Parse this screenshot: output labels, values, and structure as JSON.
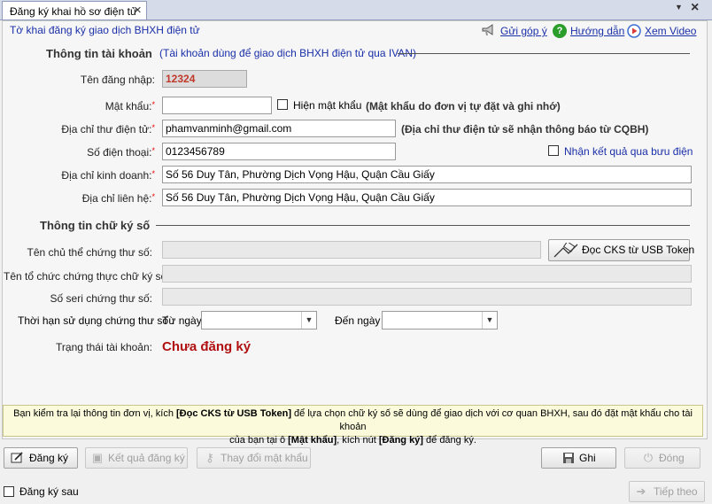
{
  "tab": {
    "title": "Đăng ký khai hồ sơ điện tử"
  },
  "header": {
    "subtitle": "Tờ khai đăng ký giao dịch BHXH điện tử",
    "feedback_label": "Gửi góp ý",
    "help_label": "Hướng dẫn",
    "video_label": "Xem Video"
  },
  "account": {
    "section_title": "Thông tin tài khoản",
    "section_note": "(Tài khoản dùng để giao dịch BHXH điện tử qua IVAN)",
    "username_label": "Tên đăng nhập:",
    "username_value": "12324",
    "password_label": "Mật khẩu:",
    "password_value": "",
    "show_password_label": "Hiện mật khẩu",
    "password_note": "(Mật khẩu do đơn vị tự đặt và ghi nhớ)",
    "email_label": "Địa chỉ thư điện tử:",
    "email_value": "phamvanminh@gmail.com",
    "email_note": "(Địa chỉ thư điện tử sẽ nhận thông báo từ CQBH)",
    "phone_label": "Số điện thoại:",
    "phone_value": "0123456789",
    "postal_label": "Nhận kết quả qua bưu điện",
    "business_addr_label": "Địa chỉ kinh doanh:",
    "business_addr_value": "Số 56 Duy Tân, Phường Dịch Vọng Hậu, Quận Cầu Giấy",
    "contact_addr_label": "Địa chỉ liên hệ:",
    "contact_addr_value": "Số 56 Duy Tân, Phường Dịch Vọng Hậu, Quận Cầu Giấy",
    "required_mark": "*"
  },
  "signature": {
    "section_title": "Thông tin chữ ký số",
    "owner_label": "Tên chủ thể chứng thư số:",
    "owner_value": "",
    "read_button": "Đọc CKS từ USB Token",
    "issuer_label": "Tên tổ chức chứng thực chữ ký số:",
    "issuer_value": "",
    "serial_label": "Số seri chứng thư số:",
    "serial_value": "",
    "validity_label": "Thời hạn sử dụng chứng thư số :",
    "from_label": "Từ ngày",
    "from_value": "",
    "to_label": "Đến ngày",
    "to_value": "",
    "status_label": "Trạng thái tài khoản:",
    "status_value": "Chưa đăng ký"
  },
  "note": {
    "part1": "Bạn kiểm tra lại thông tin đơn vị, kích ",
    "bold1": "[Đọc CKS từ USB Token]",
    "part2": " để lựa chọn chữ ký số sẽ dùng để giao dịch với cơ quan BHXH, sau đó đặt mật khẩu cho tài khoản",
    "part3": "của bạn tại ô ",
    "bold2": "[Mật khẩu]",
    "part4": ", kích nút ",
    "bold3": "[Đăng ký]",
    "part5": " để đăng ký."
  },
  "buttons": {
    "register": "Đăng ký",
    "result": "Kết quả đăng ký",
    "change_password": "Thay đổi mật khẩu",
    "save": "Ghi",
    "close": "Đóng",
    "next": "Tiếp theo"
  },
  "footer": {
    "register_later": "Đăng ký sau"
  },
  "colors": {
    "link": "#1a2fa8",
    "status": "#b01010",
    "required": "#e00000",
    "note_bg": "#fbfbdc"
  }
}
